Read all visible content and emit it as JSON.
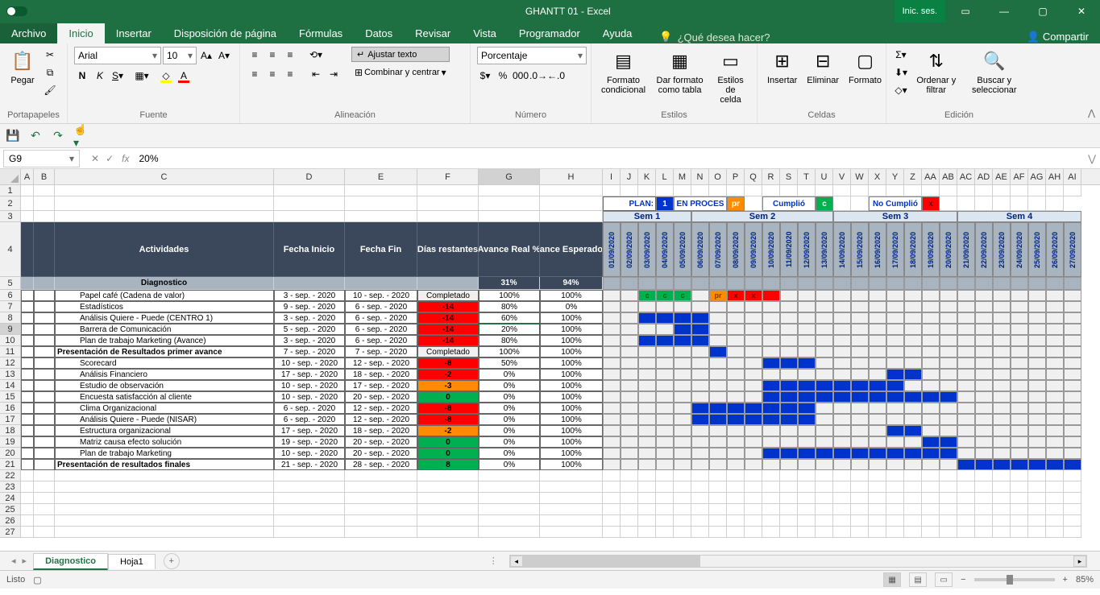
{
  "app": {
    "title": "GHANTT 01  -  Excel",
    "signin": "Inic. ses."
  },
  "menu": {
    "file": "Archivo",
    "home": "Inicio",
    "insert": "Insertar",
    "layout": "Disposición de página",
    "formulas": "Fórmulas",
    "data": "Datos",
    "review": "Revisar",
    "view": "Vista",
    "dev": "Programador",
    "help": "Ayuda",
    "tellme": "¿Qué desea hacer?",
    "share": "Compartir"
  },
  "ribbon": {
    "clipboard": "Portapapeles",
    "paste": "Pegar",
    "font_group": "Fuente",
    "align_group": "Alineación",
    "number_group": "Número",
    "styles_group": "Estilos",
    "cells_group": "Celdas",
    "editing_group": "Edición",
    "font_name": "Arial",
    "font_size": "10",
    "wrap": "Ajustar texto",
    "merge": "Combinar y centrar",
    "number_format": "Porcentaje",
    "cond_fmt": "Formato condicional",
    "as_table": "Dar formato como tabla",
    "cell_styles": "Estilos de celda",
    "insert": "Insertar",
    "delete": "Eliminar",
    "format": "Formato",
    "sort": "Ordenar y filtrar",
    "find": "Buscar y seleccionar"
  },
  "formula": {
    "cell": "G9",
    "value": "20%",
    "fx": "fx"
  },
  "columns": [
    "A",
    "B",
    "C",
    "D",
    "E",
    "F",
    "G",
    "H",
    "I",
    "J",
    "K",
    "L",
    "M",
    "N",
    "O",
    "P",
    "Q",
    "R",
    "S",
    "T",
    "U",
    "V",
    "W",
    "X",
    "Y",
    "Z",
    "AA",
    "AB",
    "AC",
    "AD",
    "AE",
    "AF",
    "AG",
    "AH",
    "AI"
  ],
  "col_widths": {
    "A": 16,
    "B": 26,
    "C": 272,
    "D": 88,
    "E": 90,
    "F": 76,
    "G": 76,
    "H": 78
  },
  "gantt_col_w": 22,
  "legend": {
    "plan": "PLAN:",
    "plan_v": "1",
    "proc": "EN PROCES",
    "proc_v": "pr",
    "cump": "Cumplió",
    "cump_v": "c",
    "nocump": "No Cumplió",
    "nocump_v": "x"
  },
  "weeks": [
    "Sem 1",
    "Sem 2",
    "Sem 3",
    "Sem 4"
  ],
  "dates": [
    "01/09/2020",
    "02/09/2020",
    "03/09/2020",
    "04/09/2020",
    "05/09/2020",
    "06/09/2020",
    "07/09/2020",
    "08/09/2020",
    "09/09/2020",
    "10/09/2020",
    "11/09/2020",
    "12/09/2020",
    "13/09/2020",
    "14/09/2020",
    "15/09/2020",
    "16/09/2020",
    "17/09/2020",
    "18/09/2020",
    "19/09/2020",
    "20/09/2020",
    "21/09/2020",
    "22/09/2020",
    "23/09/2020",
    "24/09/2020",
    "25/09/2020",
    "26/09/2020",
    "27/09/2020"
  ],
  "headers": {
    "act": "Actividades",
    "ini": "Fecha Inicio",
    "fin": "Fecha Fin",
    "dias": "Días restantes",
    "real": "Avance Real %",
    "esp": "Avance Esperado %"
  },
  "diag": {
    "label": "Diagnostico",
    "real": "31%",
    "esp": "94%"
  },
  "rows": [
    {
      "r": 6,
      "act": "Papel café (Cadena de valor)",
      "ini": "3 - sep. - 2020",
      "fin": "10 - sep. - 2020",
      "dias": "Completado",
      "dcls": "completed",
      "real": "100%",
      "esp": "100%",
      "g": [
        "",
        "",
        "c",
        "c",
        "c",
        "",
        "pr",
        "x",
        "x",
        "xr",
        "",
        "",
        "",
        "",
        "",
        "",
        "",
        "",
        "",
        "",
        "",
        "",
        "",
        "",
        "",
        "",
        ""
      ]
    },
    {
      "r": 7,
      "act": "Estadísticos",
      "ini": "9 - sep. - 2020",
      "fin": "6 - sep. - 2020",
      "dias": "-14",
      "dcls": "red",
      "real": "80%",
      "esp": "0%",
      "g": [
        "",
        "",
        "",
        "",
        "",
        "",
        "",
        "",
        "",
        "",
        "",
        "",
        "",
        "",
        "",
        "",
        "",
        "",
        "",
        "",
        "",
        "",
        "",
        "",
        "",
        "",
        ""
      ]
    },
    {
      "r": 8,
      "act": "Análisis Quiere - Puede (CENTRO 1)",
      "ini": "3 - sep. - 2020",
      "fin": "6 - sep. - 2020",
      "dias": "-14",
      "dcls": "red",
      "real": "60%",
      "esp": "100%",
      "g": [
        "",
        "",
        "b",
        "b",
        "b",
        "b",
        "",
        "",
        "",
        "",
        "",
        "",
        "",
        "",
        "",
        "",
        "",
        "",
        "",
        "",
        "",
        "",
        "",
        "",
        "",
        "",
        ""
      ]
    },
    {
      "r": 9,
      "act": "Barrera de Comunicación",
      "ini": "5 - sep. - 2020",
      "fin": "6 - sep. - 2020",
      "dias": "-14",
      "dcls": "red",
      "real": "20%",
      "esp": "100%",
      "g": [
        "",
        "",
        "",
        "",
        "b",
        "b",
        "",
        "",
        "",
        "",
        "",
        "",
        "",
        "",
        "",
        "",
        "",
        "",
        "",
        "",
        "",
        "",
        "",
        "",
        "",
        "",
        ""
      ]
    },
    {
      "r": 10,
      "act": "Plan de trabajo Marketing (Avance)",
      "ini": "3 - sep. - 2020",
      "fin": "6 - sep. - 2020",
      "dias": "-14",
      "dcls": "red",
      "real": "80%",
      "esp": "100%",
      "g": [
        "",
        "",
        "b",
        "b",
        "b",
        "b",
        "",
        "",
        "",
        "",
        "",
        "",
        "",
        "",
        "",
        "",
        "",
        "",
        "",
        "",
        "",
        "",
        "",
        "",
        "",
        "",
        ""
      ]
    },
    {
      "r": 11,
      "act": "Presentación de Resultados primer avance",
      "bold": true,
      "ini": "7 - sep. - 2020",
      "fin": "7 - sep. - 2020",
      "dias": "Completado",
      "dcls": "completed",
      "real": "100%",
      "esp": "100%",
      "g": [
        "",
        "",
        "",
        "",
        "",
        "",
        "b",
        "",
        "",
        "",
        "",
        "",
        "",
        "",
        "",
        "",
        "",
        "",
        "",
        "",
        "",
        "",
        "",
        "",
        "",
        "",
        ""
      ]
    },
    {
      "r": 12,
      "act": "Scorecard",
      "ini": "10 - sep. - 2020",
      "fin": "12 - sep. - 2020",
      "dias": "-8",
      "dcls": "red",
      "real": "50%",
      "esp": "100%",
      "g": [
        "",
        "",
        "",
        "",
        "",
        "",
        "",
        "",
        "",
        "b",
        "b",
        "b",
        "",
        "",
        "",
        "",
        "",
        "",
        "",
        "",
        "",
        "",
        "",
        "",
        "",
        "",
        ""
      ]
    },
    {
      "r": 13,
      "act": "Análisis Financiero",
      "ini": "17 - sep. - 2020",
      "fin": "18 - sep. - 2020",
      "dias": "-2",
      "dcls": "red",
      "real": "0%",
      "esp": "100%",
      "g": [
        "",
        "",
        "",
        "",
        "",
        "",
        "",
        "",
        "",
        "",
        "",
        "",
        "",
        "",
        "",
        "",
        "b",
        "b",
        "",
        "",
        "",
        "",
        "",
        "",
        "",
        "",
        ""
      ]
    },
    {
      "r": 14,
      "act": "Estudio de observación",
      "ini": "10 - sep. - 2020",
      "fin": "17 - sep. - 2020",
      "dias": "-3",
      "dcls": "orange",
      "real": "0%",
      "esp": "100%",
      "g": [
        "",
        "",
        "",
        "",
        "",
        "",
        "",
        "",
        "",
        "b",
        "b",
        "b",
        "b",
        "b",
        "b",
        "b",
        "b",
        "",
        "",
        "",
        "",
        "",
        "",
        "",
        "",
        "",
        ""
      ]
    },
    {
      "r": 15,
      "act": "Encuesta satisfacción al cliente",
      "ini": "10 - sep. - 2020",
      "fin": "20 - sep. - 2020",
      "dias": "0",
      "dcls": "green",
      "real": "0%",
      "esp": "100%",
      "g": [
        "",
        "",
        "",
        "",
        "",
        "",
        "",
        "",
        "",
        "b",
        "b",
        "b",
        "b",
        "b",
        "b",
        "b",
        "b",
        "b",
        "b",
        "b",
        "",
        "",
        "",
        "",
        "",
        "",
        ""
      ]
    },
    {
      "r": 16,
      "act": "Clima Organizacional",
      "ini": "6 - sep. - 2020",
      "fin": "12 - sep. - 2020",
      "dias": "-8",
      "dcls": "red",
      "real": "0%",
      "esp": "100%",
      "g": [
        "",
        "",
        "",
        "",
        "",
        "b",
        "b",
        "b",
        "b",
        "b",
        "b",
        "b",
        "",
        "",
        "",
        "",
        "",
        "",
        "",
        "",
        "",
        "",
        "",
        "",
        "",
        "",
        ""
      ]
    },
    {
      "r": 17,
      "act": "Análisis Quiere - Puede (NISAR)",
      "ini": "6 - sep. - 2020",
      "fin": "12 - sep. - 2020",
      "dias": "-8",
      "dcls": "red",
      "real": "0%",
      "esp": "100%",
      "g": [
        "",
        "",
        "",
        "",
        "",
        "b",
        "b",
        "b",
        "b",
        "b",
        "b",
        "b",
        "",
        "",
        "",
        "",
        "",
        "",
        "",
        "",
        "",
        "",
        "",
        "",
        "",
        "",
        ""
      ]
    },
    {
      "r": 18,
      "act": "Estructura organizacional",
      "ini": "17 - sep. - 2020",
      "fin": "18 - sep. - 2020",
      "dias": "-2",
      "dcls": "orange",
      "real": "0%",
      "esp": "100%",
      "g": [
        "",
        "",
        "",
        "",
        "",
        "",
        "",
        "",
        "",
        "",
        "",
        "",
        "",
        "",
        "",
        "",
        "b",
        "b",
        "",
        "",
        "",
        "",
        "",
        "",
        "",
        "",
        ""
      ]
    },
    {
      "r": 19,
      "act": "Matriz causa efecto solución",
      "ini": "19 - sep. - 2020",
      "fin": "20 - sep. - 2020",
      "dias": "0",
      "dcls": "green",
      "real": "0%",
      "esp": "100%",
      "g": [
        "",
        "",
        "",
        "",
        "",
        "",
        "",
        "",
        "",
        "",
        "",
        "",
        "",
        "",
        "",
        "",
        "",
        "",
        "b",
        "b",
        "",
        "",
        "",
        "",
        "",
        "",
        ""
      ]
    },
    {
      "r": 20,
      "act": "Plan de trabajo Marketing",
      "ini": "10 - sep. - 2020",
      "fin": "20 - sep. - 2020",
      "dias": "0",
      "dcls": "green",
      "real": "0%",
      "esp": "100%",
      "g": [
        "",
        "",
        "",
        "",
        "",
        "",
        "",
        "",
        "",
        "b",
        "b",
        "b",
        "b",
        "b",
        "b",
        "b",
        "b",
        "b",
        "b",
        "b",
        "",
        "",
        "",
        "",
        "",
        "",
        ""
      ]
    },
    {
      "r": 21,
      "act": "Presentación de resultados finales",
      "bold": true,
      "ini": "21 - sep. - 2020",
      "fin": "28 - sep. - 2020",
      "dias": "8",
      "dcls": "green",
      "real": "0%",
      "esp": "100%",
      "g": [
        "",
        "",
        "",
        "",
        "",
        "",
        "",
        "",
        "",
        "",
        "",
        "",
        "",
        "",
        "",
        "",
        "",
        "",
        "",
        "",
        "b",
        "b",
        "b",
        "b",
        "b",
        "b",
        "b"
      ]
    }
  ],
  "sheets": {
    "active": "Diagnostico",
    "other": "Hoja1"
  },
  "status": {
    "ready": "Listo",
    "zoom": "85%"
  }
}
